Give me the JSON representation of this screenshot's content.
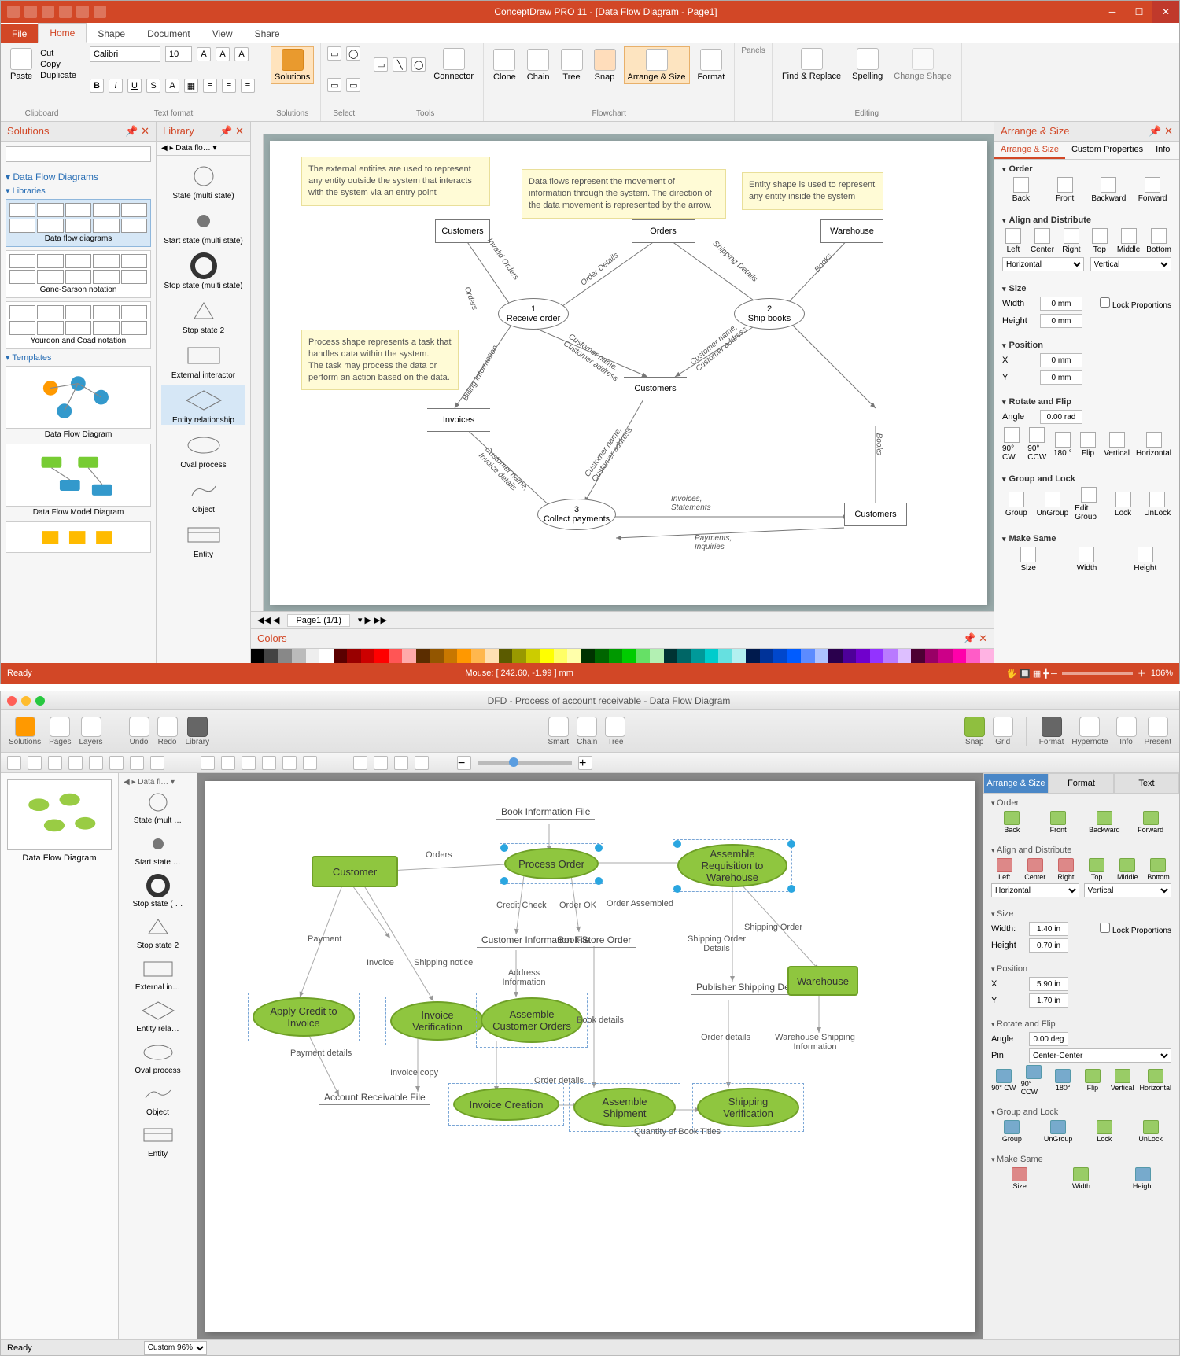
{
  "win": {
    "title": "ConceptDraw PRO 11 - [Data Flow Diagram - Page1]",
    "tabs": [
      "File",
      "Home",
      "Shape",
      "Document",
      "View",
      "Share"
    ],
    "ribbon": {
      "clipboard": {
        "paste": "Paste",
        "cut": "Cut",
        "copy": "Copy",
        "duplicate": "Duplicate",
        "label": "Clipboard"
      },
      "textformat": {
        "font": "Calibri",
        "size": "10",
        "label": "Text format"
      },
      "solutions": {
        "btn": "Solutions",
        "label": "Solutions"
      },
      "select": {
        "label": "Select"
      },
      "tools": {
        "connector": "Connector",
        "label": "Tools"
      },
      "flowchart": {
        "clone": "Clone",
        "chain": "Chain",
        "tree": "Tree",
        "snap": "Snap",
        "arrange": "Arrange & Size",
        "format": "Format",
        "label": "Flowchart"
      },
      "panels": {
        "label": "Panels"
      },
      "editing": {
        "find": "Find & Replace",
        "spelling": "Spelling",
        "change": "Change Shape",
        "label": "Editing"
      }
    },
    "solutions": {
      "title": "Solutions",
      "search_ph": "",
      "current": "Data Flow Diagrams",
      "libs_head": "Libraries",
      "libs": [
        "Data flow diagrams",
        "Gane-Sarson notation",
        "Yourdon and Coad notation"
      ],
      "templates_head": "Templates",
      "templates": [
        "Data Flow Diagram",
        "Data Flow Model Diagram"
      ]
    },
    "library": {
      "title": "Library",
      "crumb": "Data flo…",
      "items": [
        "State (multi state)",
        "Start state (multi state)",
        "Stop state (multi state)",
        "Stop state 2",
        "External interactor",
        "Entity relationship",
        "Oval process",
        "Object",
        "Entity"
      ]
    },
    "canvas": {
      "notes": [
        "The external entities are used to represent any entity outside the system that interacts with the system via an entry point",
        "Data flows represent the movement of information through the system. The direction of the data movement is represented by the arrow.",
        "Entity shape is used to represent any entity inside the system",
        "Process shape represents a task that handles data within the system.\nThe task may process the data or perform an action based on the data."
      ],
      "shapes": {
        "customers1": "Customers",
        "orders": "Orders",
        "warehouse": "Warehouse",
        "p1_num": "1",
        "p1": "Receive order",
        "p2_num": "2",
        "p2": "Ship books",
        "invoices": "Invoices",
        "customers_store": "Customers",
        "customers2": "Customers",
        "p3_num": "3",
        "p3": "Collect payments"
      },
      "edges": {
        "invalid": "Invalid Orders",
        "orderdet": "Order Details",
        "shipdet": "Shipping Details",
        "books1": "Books",
        "orders_e": "Orders",
        "billing": "Billing Information",
        "custaddr1": "Customer name,\nCustomer address",
        "custaddr2": "Customer name,\nCustomer address",
        "custaddr3": "Customer name,\nCustomer address",
        "custinv": "Customer name,\nInvoice details",
        "invstmt": "Invoices,\nStatements",
        "books2": "Books",
        "payinq": "Payments,\nInquiries"
      },
      "pagetab": "Page1 (1/1)"
    },
    "arrange": {
      "title": "Arrange & Size",
      "tabs": [
        "Arrange & Size",
        "Custom Properties",
        "Info"
      ],
      "order": {
        "head": "Order",
        "back": "Back",
        "front": "Front",
        "backward": "Backward",
        "forward": "Forward"
      },
      "align": {
        "head": "Align and Distribute",
        "left": "Left",
        "center": "Center",
        "right": "Right",
        "top": "Top",
        "middle": "Middle",
        "bottom": "Bottom",
        "h": "Horizontal",
        "v": "Vertical"
      },
      "size": {
        "head": "Size",
        "wlab": "Width",
        "w": "0 mm",
        "hlab": "Height",
        "h": "0 mm",
        "lockp": "Lock Proportions"
      },
      "pos": {
        "head": "Position",
        "xlab": "X",
        "x": "0 mm",
        "ylab": "Y",
        "y": "0 mm"
      },
      "rot": {
        "head": "Rotate and Flip",
        "anglelab": "Angle",
        "angle": "0.00 rad",
        "cw": "90° CW",
        "ccw": "90° CCW",
        "r180": "180 °",
        "flip": "Flip",
        "vert": "Vertical",
        "horiz": "Horizontal"
      },
      "group": {
        "head": "Group and Lock",
        "group": "Group",
        "ungroup": "UnGroup",
        "edit": "Edit Group",
        "lock": "Lock",
        "unlock": "UnLock"
      },
      "same": {
        "head": "Make Same",
        "size": "Size",
        "width": "Width",
        "height": "Height"
      }
    },
    "colors_title": "Colors",
    "status": {
      "ready": "Ready",
      "mouse": "Mouse: [ 242.60, -1.99 ] mm",
      "zoom": "106%"
    }
  },
  "mac": {
    "title": "DFD - Process of account receivable - Data Flow Diagram",
    "toolbar": {
      "solutions": "Solutions",
      "pages": "Pages",
      "layers": "Layers",
      "undo": "Undo",
      "redo": "Redo",
      "library": "Library",
      "smart": "Smart",
      "chain": "Chain",
      "tree": "Tree",
      "snap": "Snap",
      "grid": "Grid",
      "format": "Format",
      "hypernote": "Hypernote",
      "info": "Info",
      "present": "Present"
    },
    "thumb_label": "Data Flow Diagram",
    "lib_crumb": "Data fl…",
    "lib_items": [
      "State (mult …",
      "Start state …",
      "Stop state ( …",
      "Stop state 2",
      "External in…",
      "Entity rela…",
      "Oval process",
      "Object",
      "Entity"
    ],
    "nodes": {
      "customer": "Customer",
      "process_order": "Process Order",
      "assemble_req": "Assemble Requisition to Warehouse",
      "apply_credit": "Apply Credit to Invoice",
      "invoice_ver": "Invoice Verification",
      "assemble_cust": "Assemble Customer Orders",
      "invoice_creation": "Invoice Creation",
      "assemble_ship": "Assemble Shipment",
      "shipping_ver": "Shipping Verification",
      "warehouse": "Warehouse"
    },
    "stores": {
      "book_info": "Book Information File",
      "cust_info": "Customer Information File",
      "book_store": "Book Store Order",
      "pub_ship": "Publisher Shipping Details",
      "acct_recv": "Account Receivable File"
    },
    "edges": {
      "orders": "Orders",
      "credit": "Credit Check",
      "orderok": "Order OK",
      "assembled": "Order Assembled",
      "shiporder": "Shipping Order",
      "shipdet": "Shipping Order Details",
      "warehouseship": "Warehouse Shipping Information",
      "payment": "Payment",
      "invoice": "Invoice",
      "shipnotice": "Shipping notice",
      "addrinfo": "Address Information",
      "paymentdet": "Payment details",
      "invoicecopy": "Invoice copy",
      "orderdet1": "Order details",
      "bookdet": "Book details",
      "orderdet2": "Order details",
      "qty": "Quantity of Book Titles"
    },
    "arrange": {
      "tabs": [
        "Arrange & Size",
        "Format",
        "Text"
      ],
      "order": {
        "head": "Order",
        "back": "Back",
        "front": "Front",
        "backward": "Backward",
        "forward": "Forward"
      },
      "align": {
        "head": "Align and Distribute",
        "left": "Left",
        "center": "Center",
        "right": "Right",
        "top": "Top",
        "middle": "Middle",
        "bottom": "Bottom",
        "h": "Horizontal",
        "v": "Vertical"
      },
      "size": {
        "head": "Size",
        "wlab": "Width:",
        "w": "1.40 in",
        "hlab": "Height",
        "h": "0.70 in",
        "lockp": "Lock Proportions"
      },
      "pos": {
        "head": "Position",
        "xlab": "X",
        "x": "5.90 in",
        "ylab": "Y",
        "y": "1.70 in"
      },
      "rot": {
        "head": "Rotate and Flip",
        "anglelab": "Angle",
        "angle": "0.00 deg",
        "pinlab": "Pin",
        "pin": "Center-Center",
        "cw": "90° CW",
        "ccw": "90° CCW",
        "r180": "180°",
        "flip": "Flip",
        "vert": "Vertical",
        "horiz": "Horizontal"
      },
      "group": {
        "head": "Group and Lock",
        "group": "Group",
        "ungroup": "UnGroup",
        "lock": "Lock",
        "unlock": "UnLock"
      },
      "same": {
        "head": "Make Same",
        "size": "Size",
        "width": "Width",
        "height": "Height"
      }
    },
    "status": {
      "ready": "Ready",
      "custom": "Custom 96%"
    }
  },
  "colors": [
    "#000",
    "#444",
    "#888",
    "#bbb",
    "#eee",
    "#fff",
    "#5b0000",
    "#900",
    "#c00",
    "#f00",
    "#f55",
    "#faa",
    "#5b2d00",
    "#935600",
    "#c87700",
    "#ff9800",
    "#ffb74d",
    "#ffe0b2",
    "#5b5b00",
    "#999900",
    "#cccc00",
    "#ffff00",
    "#ffff66",
    "#ffffaa",
    "#003300",
    "#006600",
    "#009900",
    "#00cc00",
    "#66e066",
    "#b3f0b3",
    "#003333",
    "#006666",
    "#009999",
    "#00cccc",
    "#66e0e0",
    "#b3f0f0",
    "#001a4d",
    "#003399",
    "#0047cc",
    "#005cff",
    "#5c8bff",
    "#adc2ff",
    "#2a004d",
    "#4d0099",
    "#7000cc",
    "#9333ff",
    "#b97aff",
    "#ddbfff",
    "#4d0033",
    "#990066",
    "#cc0088",
    "#ff00aa",
    "#ff5cc7",
    "#ffb3e3"
  ]
}
